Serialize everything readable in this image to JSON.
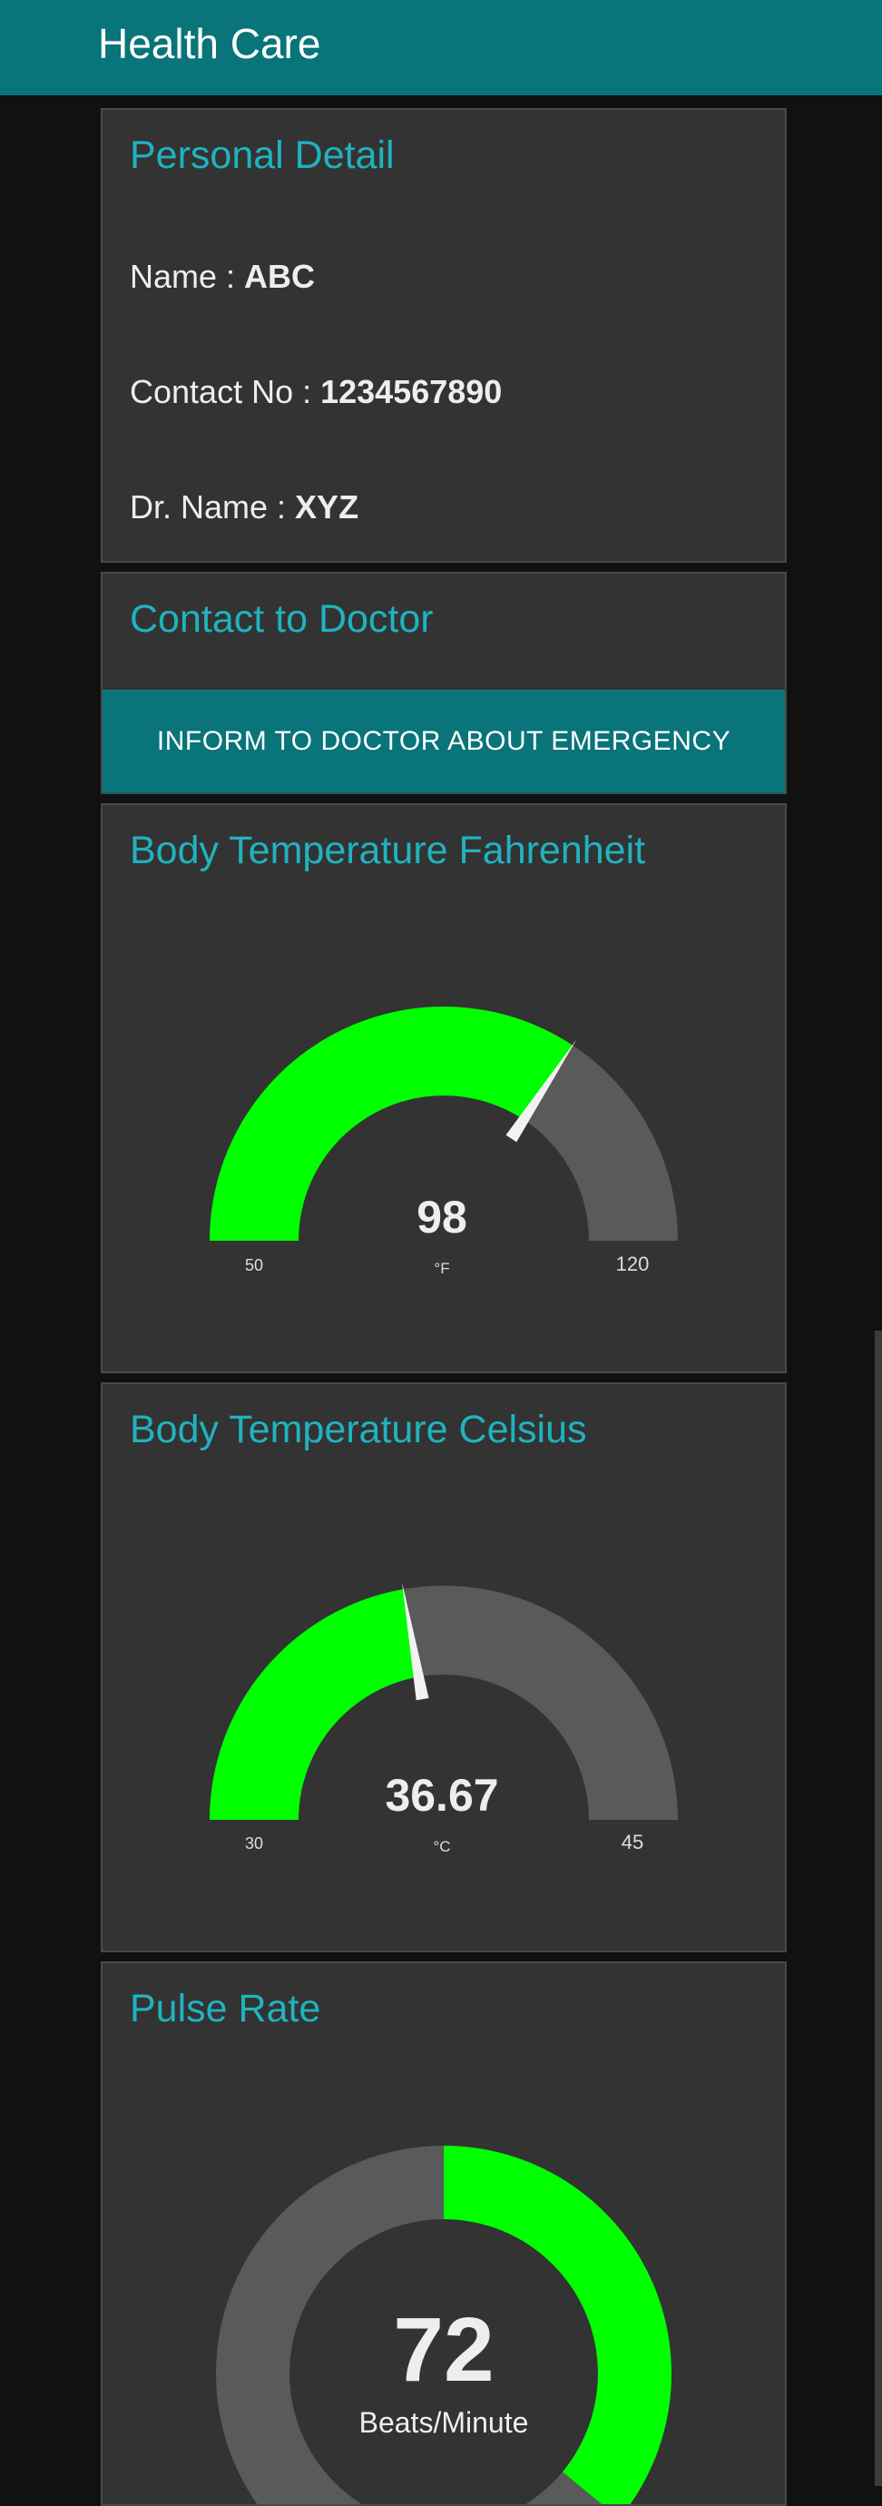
{
  "app": {
    "title": "Health Care"
  },
  "personal": {
    "title": "Personal Detail",
    "name_label": "Name : ",
    "name_value": "ABC",
    "contact_label": "Contact No : ",
    "contact_value": "1234567890",
    "doctor_label": "Dr. Name : ",
    "doctor_value": "XYZ"
  },
  "contact": {
    "title": "Contact to Doctor",
    "button_label": "INFORM TO DOCTOR ABOUT EMERGENCY"
  },
  "fahrenheit": {
    "title": "Body Temperature Fahrenheit",
    "value": "98",
    "unit": "°F",
    "min": "50",
    "max": "120",
    "reading": 98,
    "range": [
      50,
      120
    ]
  },
  "celsius": {
    "title": "Body Temperature Celsius",
    "value": "36.67",
    "unit": "°C",
    "min": "30",
    "max": "45",
    "reading": 36.67,
    "range": [
      30,
      45
    ]
  },
  "pulse": {
    "title": "Pulse Rate",
    "value": "72",
    "unit": "Beats/Minute",
    "reading": 72,
    "range": [
      0,
      200
    ]
  },
  "colors": {
    "accent": "#097479",
    "title_teal": "#1fb3bf",
    "gauge_fill": "#00ff00",
    "gauge_track": "#5a5a5a",
    "card": "#333333",
    "background": "#111111"
  }
}
